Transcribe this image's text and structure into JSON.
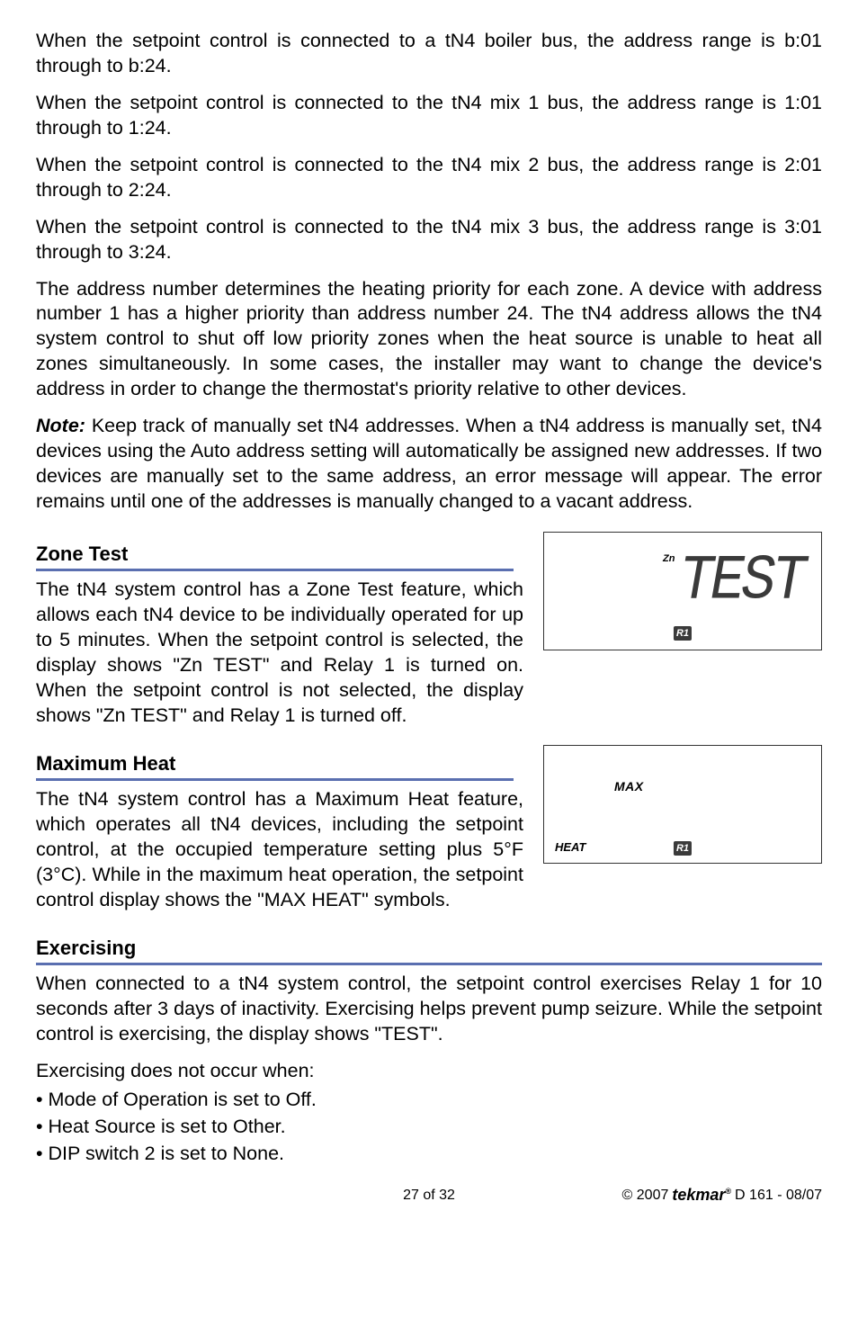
{
  "paragraphs": {
    "p1": "When the setpoint control is connected to a tN4 boiler bus, the address range is b:01 through to b:24.",
    "p2": "When the setpoint control is connected to the tN4 mix 1 bus, the address range is 1:01 through to 1:24.",
    "p3": "When the setpoint control is connected to the tN4 mix 2 bus, the address range is 2:01 through to 2:24.",
    "p4": "When the setpoint control is connected to the tN4 mix 3 bus, the address range is 3:01 through to 3:24.",
    "p5": "The address number determines the heating priority for each zone. A device with address number 1 has a higher priority than address number 24. The tN4 address allows the tN4 system control to shut off low priority zones when the heat source is unable to heat all zones simultaneously. In some cases, the installer may want to change the device's address in order to change the thermostat's priority relative to other devices.",
    "note_label": "Note:",
    "p6": " Keep track of manually set tN4 addresses. When a tN4 address is manually set, tN4 devices using the Auto address setting will automatically be assigned new addresses. If two devices are manually set to the same address, an error message will appear. The error remains until one of the addresses is manually changed to a vacant address."
  },
  "sections": {
    "zone_test": {
      "heading": "Zone Test",
      "body": "The tN4 system control has a Zone Test feature, which allows each tN4 device to be individually operated for up to 5 minutes. When the setpoint control is selected, the display shows \"Zn TEST\" and Relay 1 is turned on. When the setpoint control is not selected, the display shows \"Zn TEST\" and Relay 1 is turned off."
    },
    "max_heat": {
      "heading": "Maximum Heat",
      "body": "The tN4 system control has a Maximum Heat feature, which operates all tN4 devices, including the setpoint control, at the occupied temperature setting plus 5°F (3°C). While in the maximum heat operation, the setpoint control display shows the \"MAX HEAT\" symbols."
    },
    "exercising": {
      "heading": "Exercising",
      "body": "When connected to a tN4 system control, the setpoint control exercises Relay 1 for 10 seconds after 3 days of inactivity. Exercising helps prevent pump seizure. While the setpoint control is exercising, the display shows \"TEST\".",
      "subline": "Exercising does not occur when:",
      "bullets": [
        "Mode of Operation is set to Off.",
        "Heat Source is set to Other.",
        "DIP switch 2 is set to None."
      ]
    }
  },
  "display1": {
    "zn": "Zn",
    "readout": "TEST",
    "r1": "R1"
  },
  "display2": {
    "max": "MAX",
    "heat": "HEAT",
    "r1": "R1"
  },
  "footer": {
    "page": "27 of 32",
    "copyright": "© 2007",
    "brand": "tekmar",
    "doc": " D 161 - 08/07"
  }
}
